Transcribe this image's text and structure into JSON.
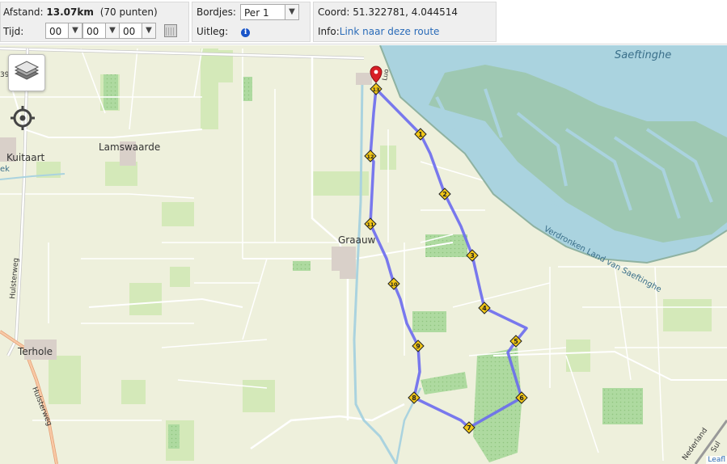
{
  "stats": {
    "distance_label": "Afstand:",
    "distance_value": "13.07km",
    "points": "(70 punten)",
    "time_label": "Tijd:",
    "hours": "00",
    "minutes": "00",
    "seconds": "00"
  },
  "signs": {
    "label": "Bordjes:",
    "selected": "Per 1",
    "legend_label": "Uitleg:"
  },
  "coords": {
    "label": "Coord:",
    "value": "51.322781, 4.044514",
    "info_label": "Info:",
    "link_text": "Link naar deze route"
  },
  "map": {
    "places": {
      "saeftinghe": "Saeftinghe",
      "lamswaarde": "Lamswaarde",
      "kuitaart": "Kuitaart",
      "graauw": "Graauw",
      "terhole": "Terhole",
      "verdronken": "Verdronken Land van Saeftinghe",
      "hulsterweg": "Hulsterweg",
      "hulsterweg2": "Hulsterweg",
      "nederland": "Nederland",
      "luo": "Luo",
      "ek": "ek",
      "s39": "39",
      "sul": "Sul",
      "leafl": "Leafl"
    },
    "waypoints": [
      "1",
      "2",
      "3",
      "4",
      "5",
      "6",
      "7",
      "8",
      "9",
      "10",
      "11",
      "12",
      "13"
    ],
    "colors": {
      "route": "#6a6aee",
      "water": "#aad3df",
      "mudflat": "#9ec8b2",
      "marker": "#f2c716"
    }
  }
}
